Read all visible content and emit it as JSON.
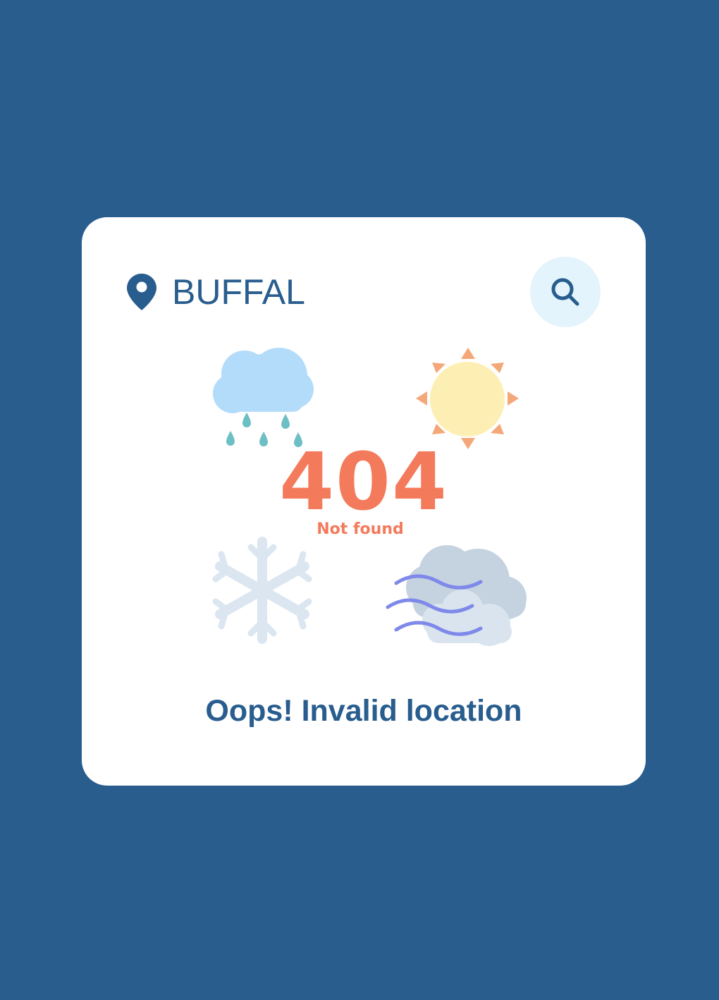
{
  "location": {
    "value": "BUFFAL",
    "icon": "location-pin-icon"
  },
  "search": {
    "icon": "search-icon"
  },
  "illustration": {
    "icons": [
      "rain-cloud-icon",
      "sun-icon",
      "snowflake-icon",
      "wind-cloud-icon"
    ]
  },
  "error": {
    "code": "404",
    "label": "Not found",
    "message": "Oops! Invalid location"
  },
  "colors": {
    "background": "#285d8e",
    "card": "#ffffff",
    "primary": "#285d8e",
    "accent": "#f47a5c",
    "search_bg": "#e3f4fc"
  }
}
